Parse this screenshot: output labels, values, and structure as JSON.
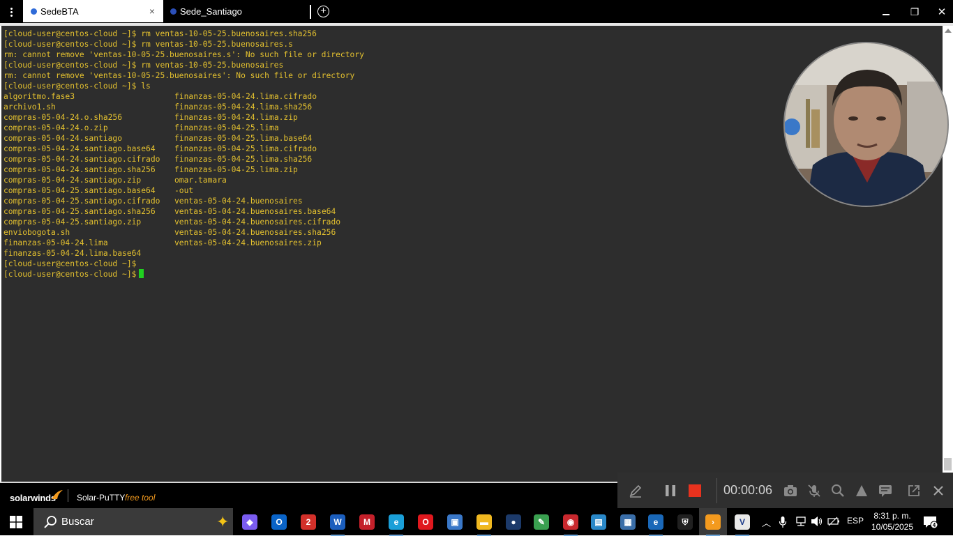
{
  "tabs": {
    "active": {
      "label": "SedeBTA",
      "dot_color": "#2f6bd8"
    },
    "inactive": {
      "label": "Sede_Santiago",
      "dot_color": "#2b4fb8"
    },
    "close_glyph": "×"
  },
  "window": {
    "maximize_glyph": "❐",
    "close_glyph": "✕"
  },
  "terminal": {
    "text_color": "#e4c12f",
    "background": "#2d2d2d",
    "command_lines": [
      "[cloud-user@centos-cloud ~]$ rm ventas-10-05-25.buenosaires.sha256",
      "[cloud-user@centos-cloud ~]$ rm ventas-10-05-25.buenosaires.s",
      "rm: cannot remove 'ventas-10-05-25.buenosaires.s': No such file or directory",
      "[cloud-user@centos-cloud ~]$ rm ventas-10-05-25.buenosaires",
      "rm: cannot remove 'ventas-10-05-25.buenosaires': No such file or directory",
      "[cloud-user@centos-cloud ~]$ ls"
    ],
    "ls_col1": [
      "algoritmo.fase3",
      "archivo1.sh",
      "compras-05-04-24.o.sha256",
      "compras-05-04-24.o.zip",
      "compras-05-04-24.santiago",
      "compras-05-04-24.santiago.base64",
      "compras-05-04-24.santiago.cifrado",
      "compras-05-04-24.santiago.sha256",
      "compras-05-04-24.santiago.zip",
      "compras-05-04-25.santiago.base64",
      "compras-05-04-25.santiago.cifrado",
      "compras-05-04-25.santiago.sha256",
      "compras-05-04-25.santiago.zip",
      "enviobogota.sh",
      "finanzas-05-04-24.lima",
      "finanzas-05-04-24.lima.base64"
    ],
    "ls_col2": [
      "finanzas-05-04-24.lima.cifrado",
      "finanzas-05-04-24.lima.sha256",
      "finanzas-05-04-24.lima.zip",
      "finanzas-05-04-25.lima",
      "finanzas-05-04-25.lima.base64",
      "finanzas-05-04-25.lima.cifrado",
      "finanzas-05-04-25.lima.sha256",
      "finanzas-05-04-25.lima.zip",
      "omar.tamara",
      "-out",
      "ventas-05-04-24.buenosaires",
      "ventas-05-04-24.buenosaires.base64",
      "ventas-05-04-24.buenosaires.cifrado",
      "ventas-05-04-24.buenosaires.sha256",
      "ventas-05-04-24.buenosaires.zip"
    ],
    "prompt_lines": [
      "[cloud-user@centos-cloud ~]$",
      "[cloud-user@centos-cloud ~]$"
    ],
    "cursor_color": "#20d020"
  },
  "status_strip": {
    "brand": "solarwinds",
    "product": "Solar-PuTTY",
    "edition": "free tool",
    "brand_accent": "#f39a1e"
  },
  "recorder": {
    "timer": "00:00:06",
    "icons": [
      "pen-icon",
      "pause-icon",
      "stop-icon",
      "camera-icon",
      "mic-muted-icon",
      "zoom-icon",
      "highlight-icon",
      "captions-icon",
      "external-icon",
      "close-icon"
    ],
    "stop_color": "#e8321e"
  },
  "taskbar": {
    "search_placeholder": "Buscar",
    "apps": [
      {
        "name": "copilot",
        "color": "#7a5cf0",
        "glyph": "◆"
      },
      {
        "name": "outlook",
        "color": "#0a64c8",
        "glyph": "O"
      },
      {
        "name": "app-red",
        "color": "#d2302a",
        "glyph": "2"
      },
      {
        "name": "word",
        "color": "#1b5ebd",
        "glyph": "W"
      },
      {
        "name": "mendeley",
        "color": "#c4202a",
        "glyph": "M"
      },
      {
        "name": "edge",
        "color": "#1a9fd8",
        "glyph": "e"
      },
      {
        "name": "opera",
        "color": "#e0181e",
        "glyph": "O"
      },
      {
        "name": "network-tool",
        "color": "#3a78c8",
        "glyph": "▣"
      },
      {
        "name": "file-explorer",
        "color": "#f0b820",
        "glyph": "▬"
      },
      {
        "name": "vpn",
        "color": "#1c3a6a",
        "glyph": "●"
      },
      {
        "name": "notepad",
        "color": "#3aa050",
        "glyph": "✎"
      },
      {
        "name": "screen-recorder",
        "color": "#c8282e",
        "glyph": "◉"
      },
      {
        "name": "remote-desktop",
        "color": "#2a88c8",
        "glyph": "▤"
      },
      {
        "name": "network-monitor",
        "color": "#3a6ea8",
        "glyph": "▦"
      },
      {
        "name": "browser",
        "color": "#1a68b8",
        "glyph": "e"
      },
      {
        "name": "security",
        "color": "#202020",
        "glyph": "⛨"
      },
      {
        "name": "solar-putty",
        "color": "#f39a1e",
        "glyph": "›"
      },
      {
        "name": "vnc-viewer",
        "color": "#e8e8e8",
        "glyph": "V"
      }
    ],
    "language": "ESP",
    "time": "8:31 p. m.",
    "date": "10/05/2025",
    "notifications": "4"
  }
}
